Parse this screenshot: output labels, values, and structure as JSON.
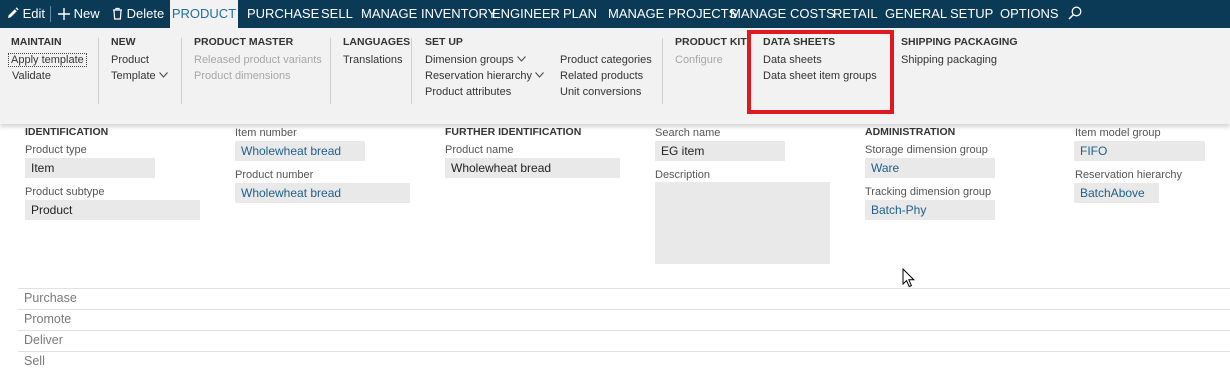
{
  "actions": {
    "edit": "Edit",
    "new": "New",
    "delete": "Delete"
  },
  "tabs": [
    "PRODUCT",
    "PURCHASE",
    "SELL",
    "MANAGE INVENTORY",
    "ENGINEER",
    "PLAN",
    "MANAGE PROJECTS",
    "MANAGE COSTS",
    "RETAIL",
    "GENERAL",
    "SETUP",
    "OPTIONS"
  ],
  "ribbon": {
    "maintain": {
      "title": "MAINTAIN",
      "items": [
        "Apply template",
        "Validate"
      ]
    },
    "new": {
      "title": "NEW",
      "items": [
        "Product",
        "Template"
      ]
    },
    "product_master": {
      "title": "PRODUCT MASTER",
      "items": [
        "Released product variants",
        "Product dimensions"
      ]
    },
    "languages": {
      "title": "LANGUAGES",
      "items": [
        "Translations"
      ]
    },
    "set_up": {
      "title": "SET UP",
      "items": [
        "Dimension groups",
        "Reservation hierarchy",
        "Product attributes",
        "Product categories",
        "Related products",
        "Unit conversions"
      ]
    },
    "product_kit": {
      "title": "PRODUCT KIT",
      "items": [
        "Configure"
      ]
    },
    "data_sheets": {
      "title": "DATA SHEETS",
      "items": [
        "Data sheets",
        "Data sheet item groups"
      ]
    },
    "shipping_packaging": {
      "title": "SHIPPING PACKAGING",
      "items": [
        "Shipping packaging"
      ]
    }
  },
  "form": {
    "identification": {
      "title": "IDENTIFICATION",
      "product_type_label": "Product type",
      "product_type": "Item",
      "product_subtype_label": "Product subtype",
      "product_subtype": "Product"
    },
    "item": {
      "item_number_label": "Item number",
      "item_number": "Wholewheat bread",
      "product_number_label": "Product number",
      "product_number": "Wholewheat bread"
    },
    "further_identification": {
      "title": "FURTHER IDENTIFICATION",
      "product_name_label": "Product name",
      "product_name": "Wholewheat bread"
    },
    "search": {
      "search_name_label": "Search name",
      "search_name": "EG item",
      "description_label": "Description",
      "description": ""
    },
    "administration": {
      "title": "ADMINISTRATION",
      "storage_label": "Storage dimension group",
      "storage": "Ware",
      "tracking_label": "Tracking dimension group",
      "tracking": "Batch-Phy"
    },
    "model": {
      "item_model_group_label": "Item model group",
      "item_model_group": "FIFO",
      "reservation_label": "Reservation hierarchy",
      "reservation": "BatchAbove"
    }
  },
  "fasttabs": [
    "Purchase",
    "Promote",
    "Deliver",
    "Sell"
  ]
}
